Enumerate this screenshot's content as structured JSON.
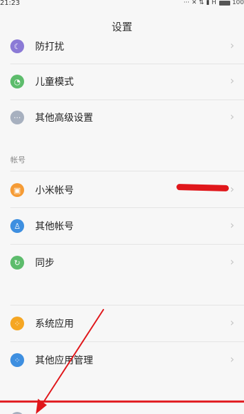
{
  "status_bar": {
    "time": "21:23",
    "battery": "100"
  },
  "header": {
    "title": "设置"
  },
  "rows": [
    {
      "label": "防打扰",
      "icon": "moon-icon",
      "color": "#8b7ad6"
    },
    {
      "label": "儿童模式",
      "icon": "child-mode-icon",
      "color": "#5dbc6c"
    },
    {
      "label": "其他高级设置",
      "icon": "more-dots-icon",
      "color": "#a7b0bf"
    },
    {
      "label": "小米帐号",
      "icon": "mi-account-icon",
      "color": "#f59b35"
    },
    {
      "label": "其他帐号",
      "icon": "person-icon",
      "color": "#3e8fe0"
    },
    {
      "label": "同步",
      "icon": "sync-icon",
      "color": "#5dbc6c"
    },
    {
      "label": "系统应用",
      "icon": "apps-icon",
      "color": "#f5a623"
    },
    {
      "label": "其他应用管理",
      "icon": "app-manage-icon",
      "color": "#3e8fe0"
    }
  ],
  "section": {
    "accounts_label": "帐号"
  },
  "annotation": {
    "arrow_color": "#e0171b"
  }
}
